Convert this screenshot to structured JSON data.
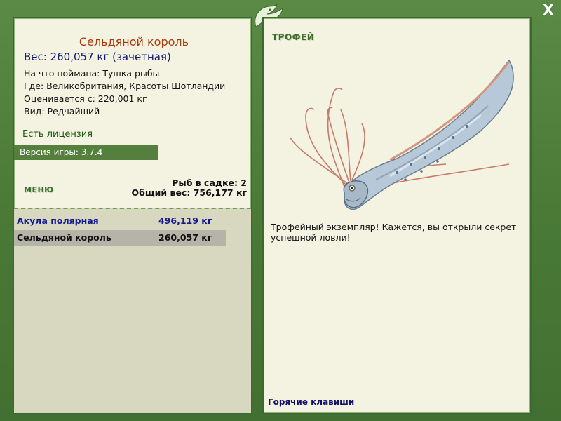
{
  "fish": {
    "title": "Сельдяной король",
    "weight_line": "Вес: 260,057 кг (зачетная)",
    "caught_on": "На что поймана: Тушка рыбы",
    "location": "Где: Великобритания, Красоты Шотландии",
    "valued_from": "Оценивается с: 220,001 кг",
    "kind": "Вид: Редчайший"
  },
  "license": "Есть лицензия",
  "version": "Версия игры: 3.7.4",
  "menu_label": "МЕНЮ",
  "keepnet": {
    "count_line": "Рыб в садке: 2",
    "total_line": "Общий вес: 756,177 кг",
    "rows": [
      {
        "name": "Акула полярная",
        "weight": "496,119 кг"
      },
      {
        "name": "Сельдяной король",
        "weight": "260,057 кг"
      }
    ]
  },
  "trophy": {
    "label": "ТРОФЕЙ",
    "description": "Трофейный экземпляр! Кажется, вы открыли секрет успешной ловли!"
  },
  "hotkeys_label": "Горячие клавиши",
  "close_label": "X",
  "icons": [
    "close-icon",
    "fish-logo-icon",
    "oarfish-image"
  ]
}
